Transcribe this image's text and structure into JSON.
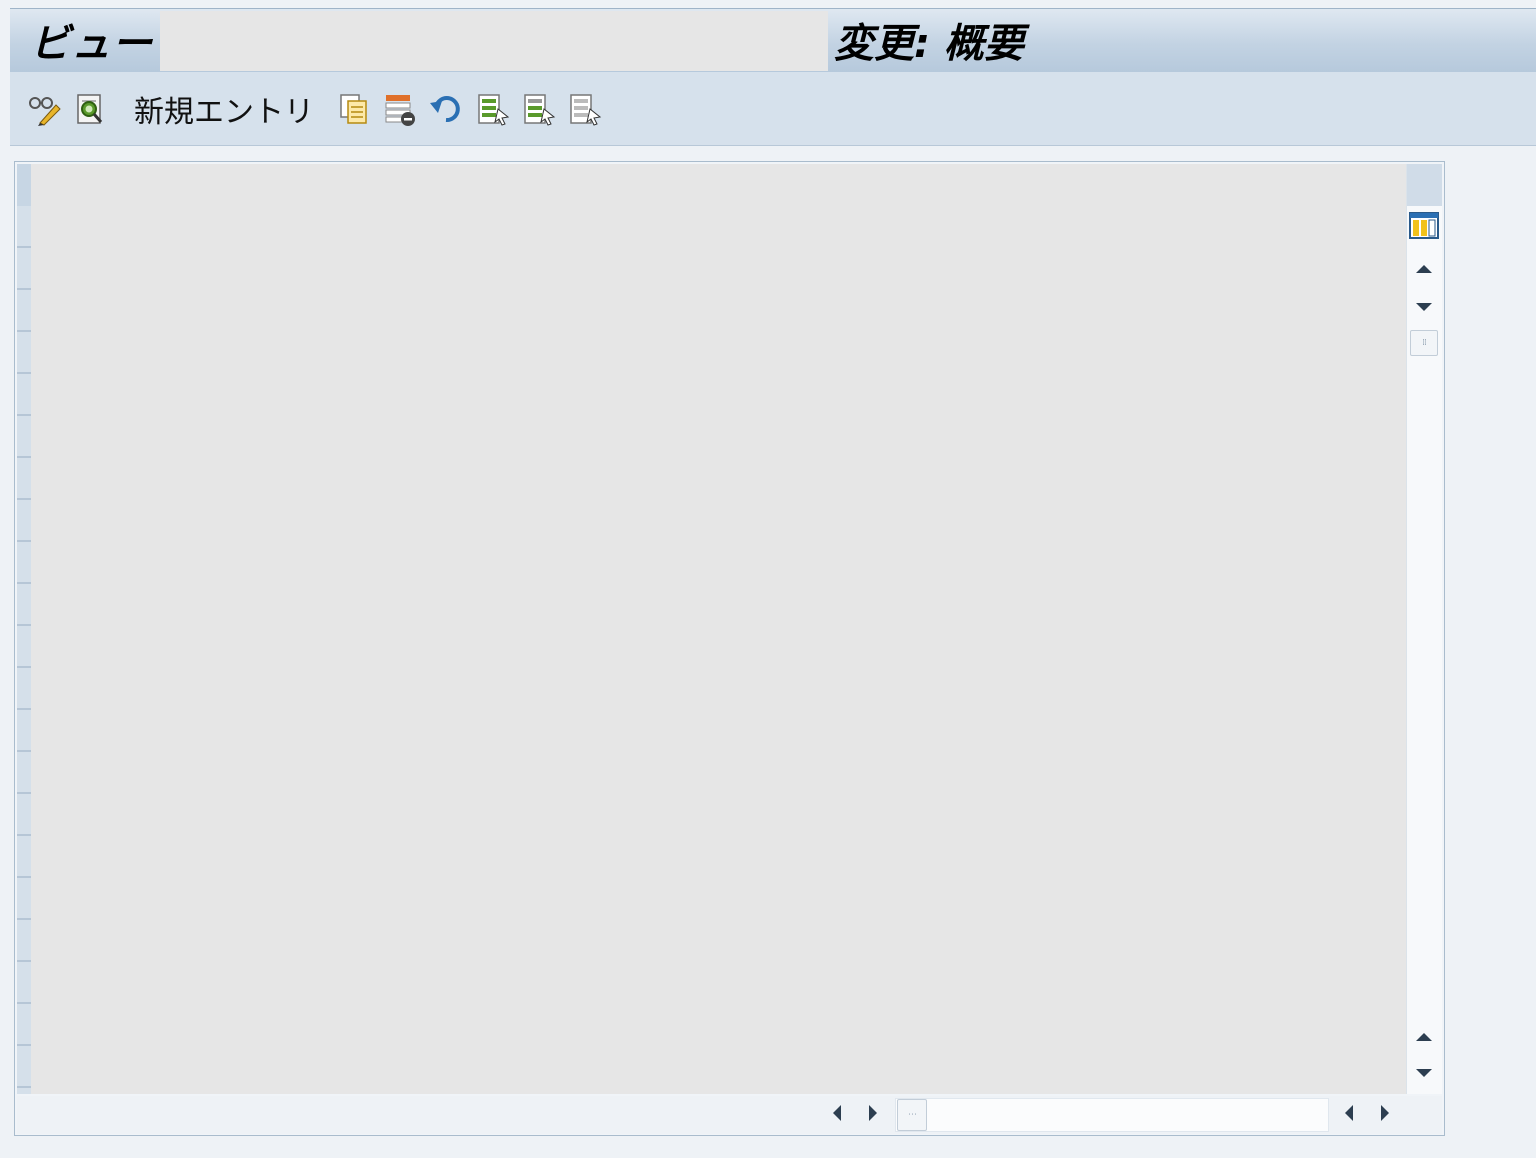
{
  "title_bar": {
    "prefix": "ビュー",
    "name": "",
    "suffix": "変更: 概要"
  },
  "toolbar": {
    "items": [
      {
        "type": "icon",
        "icon": "display-change-icon"
      },
      {
        "type": "icon",
        "icon": "find-icon"
      },
      {
        "type": "text",
        "label": "新規エントリ"
      },
      {
        "type": "icon",
        "icon": "copy-as-icon"
      },
      {
        "type": "icon",
        "icon": "delete-icon"
      },
      {
        "type": "icon",
        "icon": "undo-change-icon"
      },
      {
        "type": "icon",
        "icon": "select-all-icon"
      },
      {
        "type": "icon",
        "icon": "select-block-icon"
      },
      {
        "type": "icon",
        "icon": "deselect-all-icon"
      }
    ]
  },
  "table": {
    "settings_icon": "column-settings-icon",
    "scroll_up_icon": "arrow-up-icon",
    "scroll_down_icon": "arrow-down-icon",
    "scroll_left_icon": "arrow-left-icon",
    "scroll_right_icon": "arrow-right-icon"
  },
  "colors": {
    "title_gradient_top": "#dfe8f1",
    "title_gradient_bottom": "#b6c9dc",
    "toolbar_bg": "#d6e1ec",
    "grid_bg": "#e6e6e6",
    "icon_green": "#5a9a2b",
    "icon_orange": "#e0702a",
    "icon_blue": "#2a6fb3",
    "icon_yellow": "#f2c21b"
  }
}
